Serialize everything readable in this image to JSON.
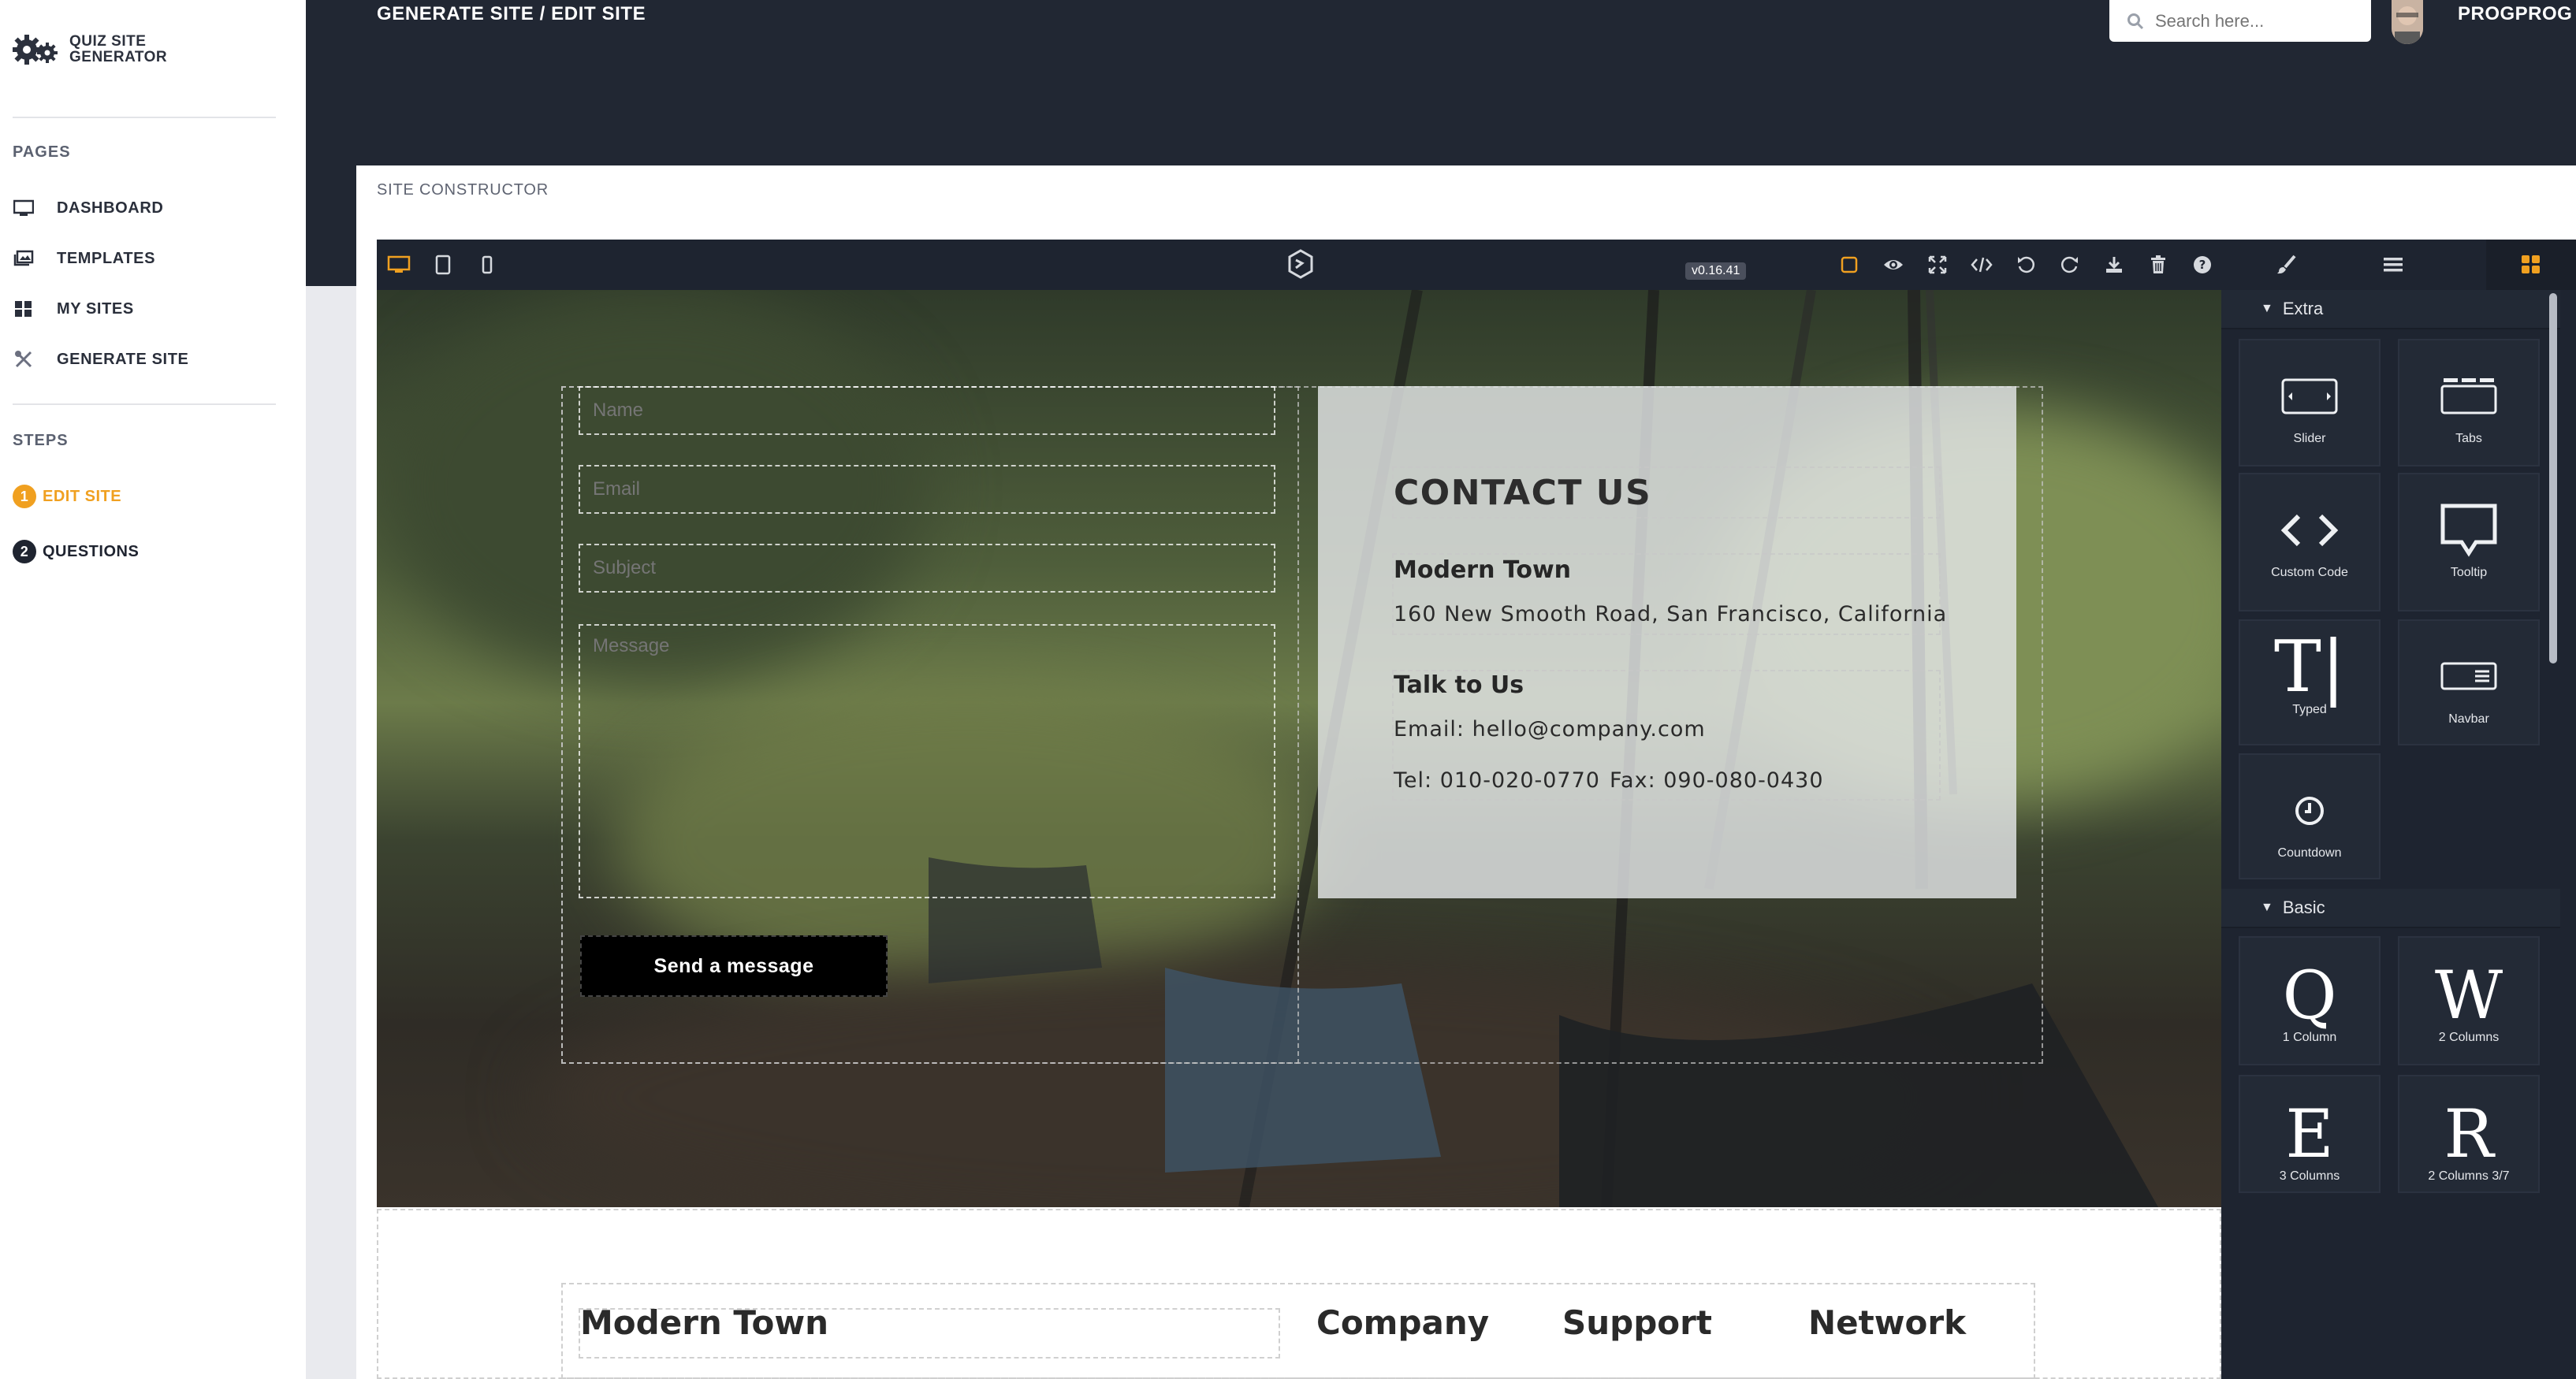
{
  "app": {
    "brand_line1": "QUIZ SITE",
    "brand_line2": "GENERATOR"
  },
  "sidebar": {
    "pages_heading": "PAGES",
    "items": [
      {
        "label": "DASHBOARD",
        "icon": "monitor-icon"
      },
      {
        "label": "TEMPLATES",
        "icon": "templates-icon"
      },
      {
        "label": "MY SITES",
        "icon": "grid-icon"
      },
      {
        "label": "GENERATE SITE",
        "icon": "tools-icon"
      }
    ],
    "steps_heading": "STEPS",
    "steps": [
      {
        "num": "1",
        "label": "EDIT SITE",
        "active": true
      },
      {
        "num": "2",
        "label": "QUESTIONS",
        "active": false
      }
    ]
  },
  "header": {
    "breadcrumb": "GENERATE SITE /  EDIT SITE",
    "search_placeholder": "Search here...",
    "username": "PROGPROG"
  },
  "card": {
    "title": "SITE CONSTRUCTOR"
  },
  "editor": {
    "version": "v0.16.41"
  },
  "form": {
    "name_placeholder": "Name",
    "email_placeholder": "Email",
    "subject_placeholder": "Subject",
    "message_placeholder": "Message",
    "send_label": "Send a message"
  },
  "contact": {
    "title": "CONTACT US",
    "town_label": "Modern Town",
    "address": "160 New Smooth Road, San Francisco, California",
    "talk_label": "Talk to Us",
    "email": "Email: hello@company.com",
    "tel": "Tel: 010-020-0770",
    "fax": "Fax: 090-080-0430"
  },
  "footer": {
    "col1": "Modern Town",
    "col2": "Company",
    "col3": "Support",
    "col4": "Network"
  },
  "blocks": {
    "extra_heading": "Extra",
    "basic_heading": "Basic",
    "extra": [
      {
        "label": "Slider",
        "icon": "slider-icon"
      },
      {
        "label": "Tabs",
        "icon": "tabs-icon"
      },
      {
        "label": "Custom Code",
        "icon": "code-icon"
      },
      {
        "label": "Tooltip",
        "icon": "tooltip-icon"
      },
      {
        "label": "Typed",
        "icon": "typed-icon"
      },
      {
        "label": "Navbar",
        "icon": "navbar-icon"
      },
      {
        "label": "Countdown",
        "icon": "clock-icon"
      }
    ],
    "basic": [
      {
        "label": "1 Column",
        "glyph": "Q"
      },
      {
        "label": "2 Columns",
        "glyph": "W"
      },
      {
        "label": "3 Columns",
        "glyph": "E"
      },
      {
        "label": "2 Columns 3/7",
        "glyph": "R"
      }
    ]
  },
  "colors": {
    "accent": "#f0a020",
    "dark_bg": "#212733",
    "panel_bg": "#1e2430"
  }
}
